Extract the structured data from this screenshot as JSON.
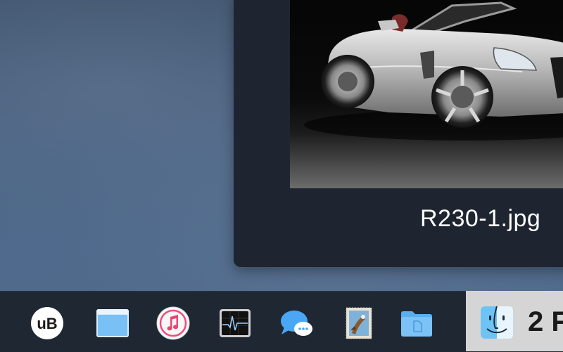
{
  "preview": {
    "file_name": "R230-1.jpg",
    "image_subject": "silver-convertible-car-photo"
  },
  "dock": {
    "items": [
      {
        "name": "uBlock",
        "label": "uB",
        "icon": "ublock-icon"
      },
      {
        "name": "Finder folder window",
        "icon": "folder-window-icon"
      },
      {
        "name": "iTunes",
        "icon": "itunes-icon"
      },
      {
        "name": "Activity Monitor",
        "icon": "activity-monitor-icon"
      },
      {
        "name": "Messages",
        "icon": "messages-icon"
      },
      {
        "name": "Mail stamp",
        "icon": "mail-stamp-icon"
      },
      {
        "name": "Documents folder",
        "icon": "documents-folder-icon"
      }
    ]
  },
  "switcher": {
    "app": "Finder",
    "label": "2 F",
    "icon": "finder-icon"
  },
  "colors": {
    "dock_background": "#1f2733",
    "preview_background": "#1e2530",
    "switcher_background": "#d5d5d5",
    "folder_blue": "#6ab8f0"
  }
}
